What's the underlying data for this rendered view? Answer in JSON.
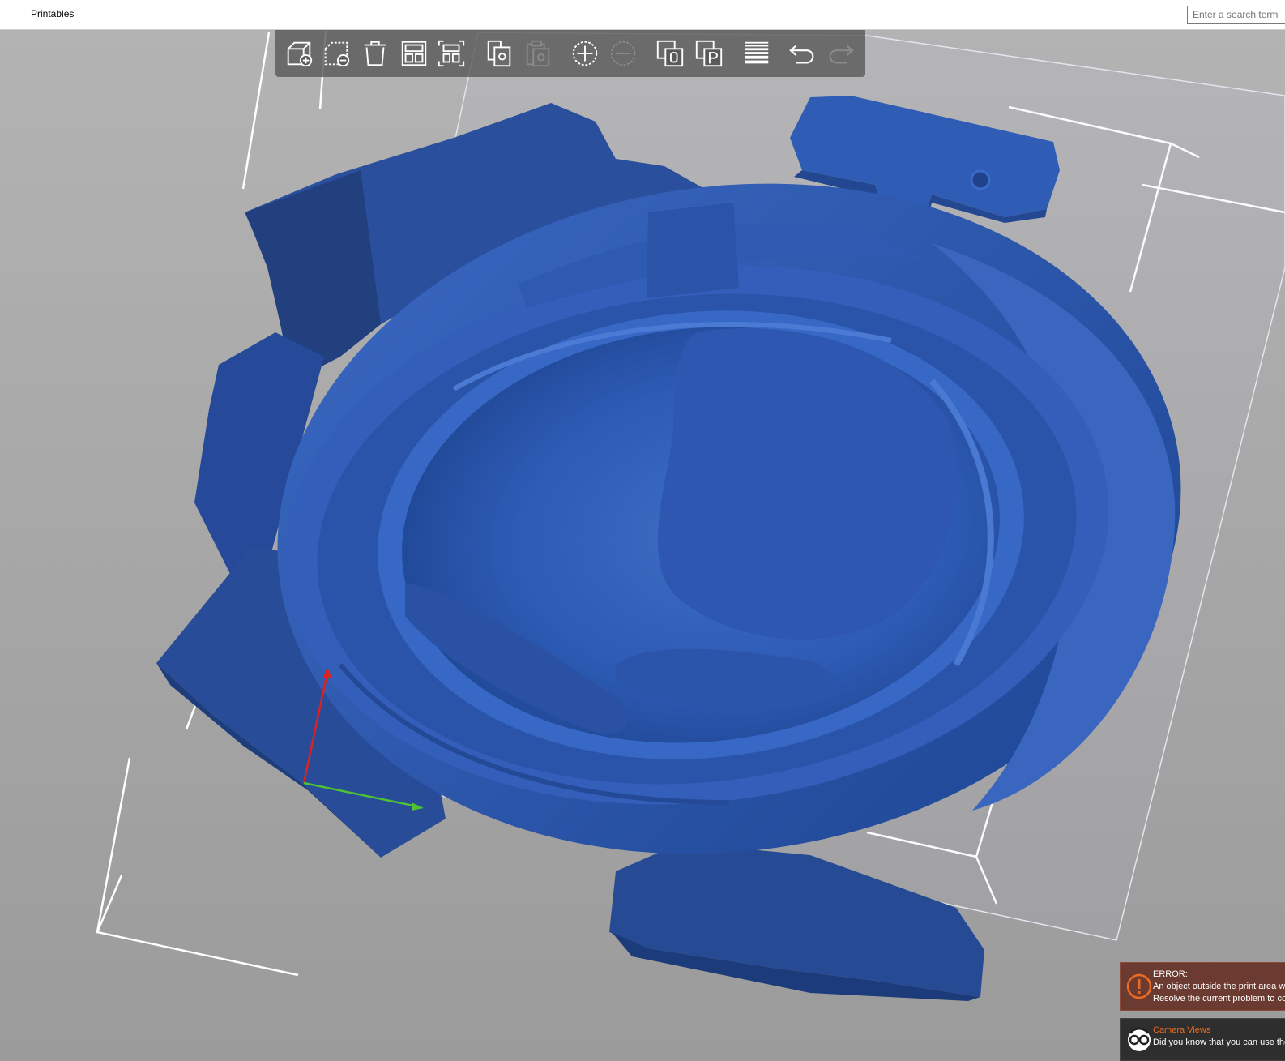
{
  "topbar": {
    "menu_label": "Printables",
    "search_placeholder": "Enter a search term"
  },
  "toolbar": {
    "buttons": [
      {
        "icon": "add-icon",
        "label": "Add"
      },
      {
        "icon": "delete-icon",
        "label": "Delete"
      },
      {
        "icon": "delete-all-icon",
        "label": "Delete all"
      },
      {
        "icon": "arrange-icon",
        "label": "Arrange"
      },
      {
        "icon": "arrange-selection-icon",
        "label": "Arrange selection"
      },
      {
        "icon": "copy-icon",
        "label": "Copy"
      },
      {
        "icon": "paste-icon",
        "label": "Paste"
      },
      {
        "icon": "add-instance-icon",
        "label": "Add instance"
      },
      {
        "icon": "remove-instance-icon",
        "label": "Remove instance"
      },
      {
        "icon": "split-objects-icon",
        "label": "Split to objects"
      },
      {
        "icon": "split-parts-icon",
        "label": "Split to parts"
      },
      {
        "icon": "variable-layer-height-icon",
        "label": "Variable layer height"
      },
      {
        "icon": "undo-icon",
        "label": "Undo"
      },
      {
        "icon": "redo-icon",
        "label": "Redo"
      }
    ]
  },
  "notifications": {
    "error": {
      "title": "ERROR:",
      "line1": "An object outside the print area was detected.",
      "line2": "Resolve the current problem to continue slicing."
    },
    "hint": {
      "title": "Camera Views",
      "line1": "Did you know that you can use the number keys"
    }
  },
  "colors": {
    "model_blue": "#2d5bb5",
    "toolbar_bg": "#5a5a5a",
    "accent_orange": "#ed6b21",
    "error_bg": "#6b3a30"
  }
}
